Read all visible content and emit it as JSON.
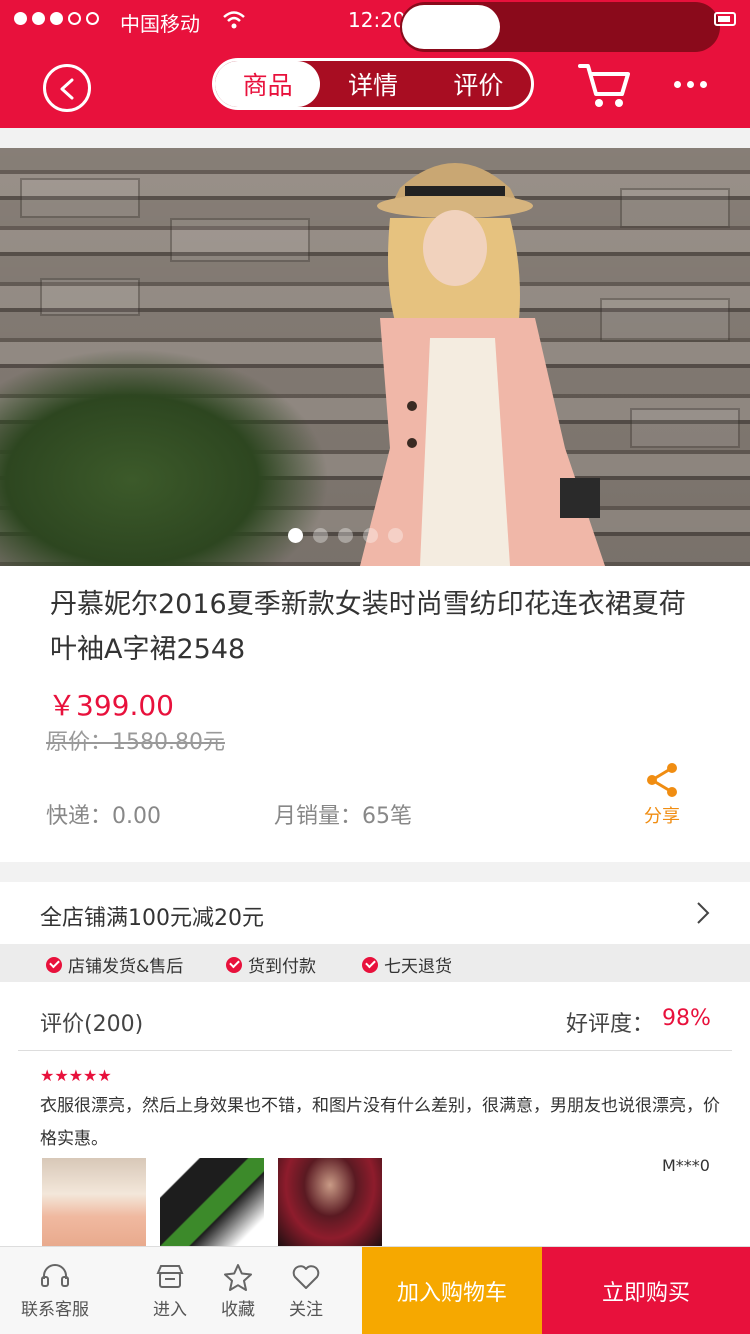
{
  "status_bar": {
    "carrier": "中国移动",
    "time": "12:20"
  },
  "header": {
    "tabs": [
      {
        "label": "商品"
      },
      {
        "label": "详情"
      },
      {
        "label": "评价"
      }
    ],
    "active_tab_index": 0,
    "accent_color": "#e8113c"
  },
  "hero": {
    "slide_count": 5,
    "active_slide": 0
  },
  "product": {
    "title": "丹慕妮尔2016夏季新款女装时尚雪纺印花连衣裙夏荷叶袖A字裙2548",
    "price": "￥399.00",
    "original_price": "原价：1580.80元",
    "shipping": "快递：0.00",
    "monthly_sales": "月销量：65笔",
    "share_label": "分享"
  },
  "promo": {
    "text": "全店铺满100元减20元"
  },
  "guarantees": [
    {
      "label": "店铺发货&售后"
    },
    {
      "label": "货到付款"
    },
    {
      "label": "七天退货"
    }
  ],
  "reviews": {
    "title": "评价(200)",
    "rating_label": "好评度：",
    "rating_value": "98%",
    "item": {
      "stars": "★★★★★",
      "text": "衣服很漂亮，然后上身效果也不错，和图片没有什么差别，很满意，男朋友也说很漂亮，价格实惠。",
      "user": "M***0"
    }
  },
  "bottom_bar": {
    "service_label": "联系客服",
    "store_label": "进入",
    "favorite_label": "收藏",
    "follow_label": "关注",
    "add_to_cart_label": "加入购物车",
    "buy_now_label": "立即购买",
    "add_to_cart_color": "#f6a800",
    "buy_now_color": "#e8113c"
  }
}
